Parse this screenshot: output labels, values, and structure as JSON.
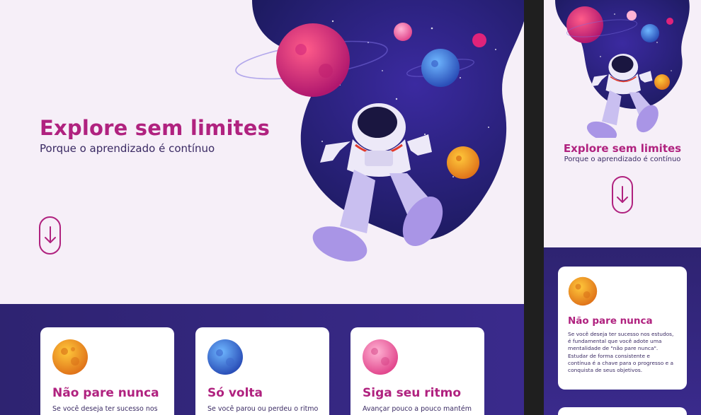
{
  "hero": {
    "title": "Explore sem limites",
    "subtitle": "Porque o aprendizado é contínuo",
    "scroll_icon": "arrow-down-icon"
  },
  "colors": {
    "brand": "#b0227f",
    "text": "#3a2a63",
    "background": "#f6eff8",
    "band": "#2e2371",
    "space": "#2a1f7a"
  },
  "cards": [
    {
      "planet": "orange-planet-icon",
      "title": "Não pare nunca",
      "text": "Se você deseja ter sucesso nos estudos, é fundamental que você adote uma mentalidade de \"não pare nunca\". Estudar de forma consistente e contínua é a chave para o progresso e a conquista de seus objetivos."
    },
    {
      "planet": "blue-planet-icon",
      "title": "Só volta",
      "text": "Se você parou ou perdeu o ritmo"
    },
    {
      "planet": "pink-planet-icon",
      "title": "Siga seu ritmo",
      "text": "Avançar pouco a pouco mantém"
    }
  ],
  "desktop_card_texts": [
    "Se você deseja ter sucesso nos",
    "Se você parou ou perdeu o ritmo",
    "Avançar pouco a pouco mantém"
  ]
}
